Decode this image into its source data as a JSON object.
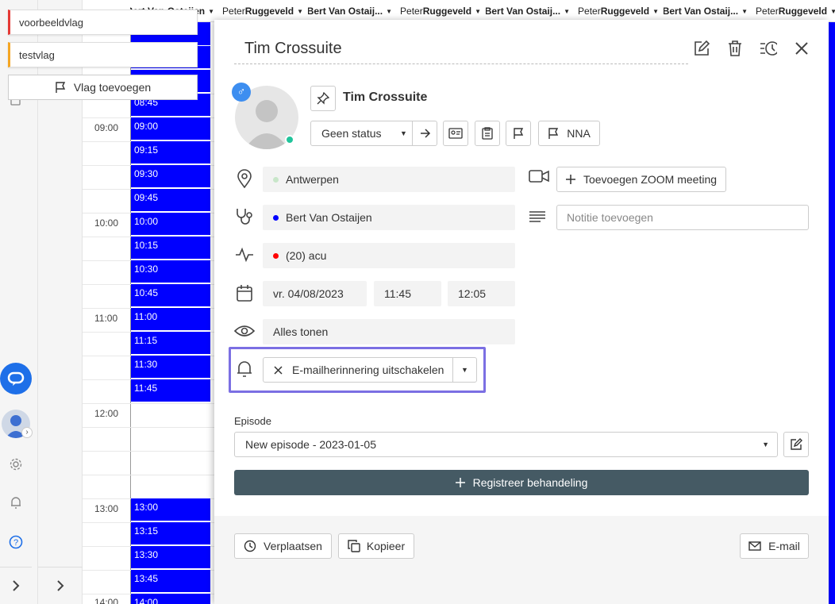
{
  "columns": [
    {
      "pre": "",
      "name": "Bert Van Ostaijen"
    },
    {
      "pre": "Peter ",
      "name": "Ruggeveld"
    },
    {
      "pre": "",
      "name": "Bert Van Ostaij..."
    },
    {
      "pre": "Peter ",
      "name": "Ruggeveld"
    },
    {
      "pre": "",
      "name": "Bert Van Ostaij..."
    },
    {
      "pre": "Peter ",
      "name": "Ruggeveld"
    },
    {
      "pre": "",
      "name": "Bert Van Ostaij..."
    },
    {
      "pre": "Peter ",
      "name": "Ruggeveld"
    }
  ],
  "hours": [
    "09:00",
    "10:00",
    "11:00",
    "12:00",
    "13:00",
    "14:00"
  ],
  "slots": {
    "s0845": "08:45",
    "s0900": "09:00",
    "s0915": "09:15",
    "s0930": "09:30",
    "s0945": "09:45",
    "s1000": "10:00",
    "s1015": "10:15",
    "s1030": "10:30",
    "s1045": "10:45",
    "s1100": "11:00",
    "s1115": "11:15",
    "s1130": "11:30",
    "s1145": "11:45",
    "s1300": "13:00",
    "s1315": "13:15",
    "s1330": "13:30",
    "s1345": "13:45",
    "s1400": "14:00"
  },
  "flags": {
    "first": "voorbeeldvlag",
    "second": "testvlag",
    "add_label": "Vlag toevoegen"
  },
  "panel": {
    "title": "Tim Crossuite",
    "patient_name": "Tim Crossuite",
    "status": "Geen status",
    "nna_label": "NNA",
    "location": "Antwerpen",
    "therapist": "Bert Van Ostaijen",
    "treatment": "(20) acu",
    "date": "vr. 04/08/2023",
    "start_time": "11:45",
    "end_time": "12:05",
    "visibility": "Alles tonen",
    "reminder": "E-mailherinnering uitschakelen",
    "zoom_label": "Toevoegen ZOOM meeting",
    "note_placeholder": "Notitie toevoegen",
    "episode_label": "Episode",
    "episode_value": "New episode - 2023-01-05",
    "register_label": "Registreer behandeling",
    "move_label": "Verplaatsen",
    "copy_label": "Kopieer",
    "email_label": "E-mail"
  },
  "colors": {
    "slot": "#0000ff",
    "highlight": "#7b6fe3",
    "register": "#455a64",
    "location_dot": "#c8e6c9",
    "therapist_dot": "#0000ff",
    "treatment_dot": "#ff0000"
  }
}
